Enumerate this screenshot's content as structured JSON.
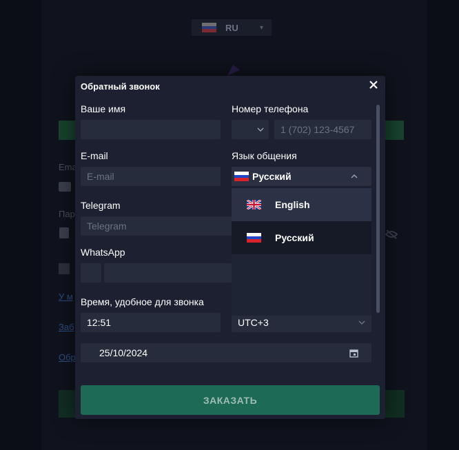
{
  "background": {
    "language_selector": {
      "label": "RU"
    },
    "email_label": "Ema",
    "password_label": "Пар",
    "link1": "У м",
    "link2": "Заб",
    "link3": "Обр"
  },
  "modal": {
    "title": "Обратный звонок",
    "name": {
      "label": "Ваше имя",
      "value": "",
      "placeholder": ""
    },
    "phone": {
      "label": "Номер телефона",
      "country_value": "",
      "placeholder": "1 (702) 123-4567"
    },
    "email": {
      "label": "E-mail",
      "placeholder": "E-mail"
    },
    "language": {
      "label": "Язык общения",
      "selected": "Русский",
      "options": [
        {
          "label": "English",
          "flag": "gb"
        },
        {
          "label": "Русский",
          "flag": "ru"
        }
      ]
    },
    "telegram": {
      "label": "Telegram",
      "placeholder": "Telegram"
    },
    "whatsapp": {
      "label": "WhatsApp",
      "value": ""
    },
    "time": {
      "label": "Время, удобное для звонка",
      "value": "12:51",
      "timezone": "UTC+3"
    },
    "date": {
      "value": "25/10/2024"
    },
    "submit_label": "ЗАКАЗАТЬ"
  },
  "colors": {
    "modal_bg": "#1c2030",
    "field_bg": "#272c3d",
    "accent_button": "#1d6a56",
    "button_text": "#9fbdb4"
  }
}
